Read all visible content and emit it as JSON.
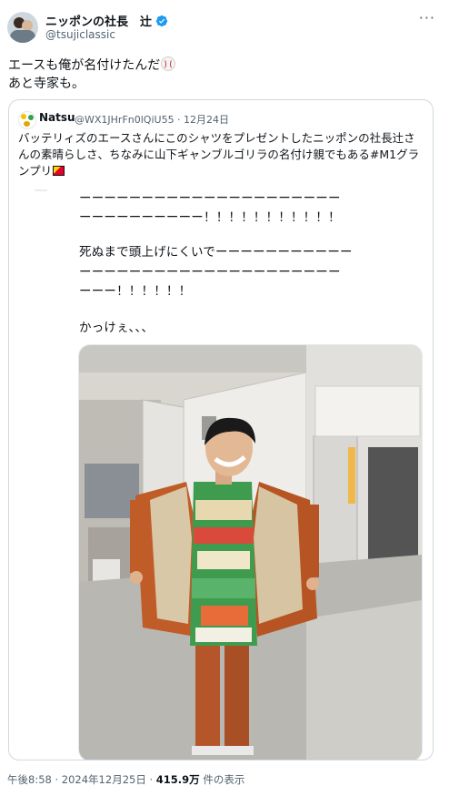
{
  "author": {
    "display_name": "ニッポンの社長　辻",
    "handle": "@tsujiclassic",
    "verified_icon": "verified-badge-icon",
    "more_label": "···"
  },
  "tweet": {
    "line1": "エースも俺が名付けたんだ",
    "line2": "あと寺家も。"
  },
  "quote": {
    "display_name": "Natsu",
    "meta": "@WX1JHrFn0lQiU55 · 12月24日",
    "text": "バッテリィズのエースさんにこのシャツをプレゼントしたニッポンの社長辻さんの素晴らしさ、ちなみに山下ギャンブルゴリラの名付け親でもある#M1グランプリ",
    "note_lines": [
      "ーーーーーーーーーーーーーーーーーーーーー",
      "ーーーーーーーーーー！！！！！！！！！！！",
      "死ぬまで頭上げにくいでーーーーーーーーーーー",
      "ーーーーーーーーーーーーーーーーーーーーー",
      "ーーー！！！！！！",
      "かっけぇ､､､"
    ]
  },
  "footer": {
    "time": "午後8:58 · 2024年12月25日 · ",
    "views": "415.9万",
    "views_suffix": " 件の表示"
  },
  "colors": {
    "accent": "#1d9bf0",
    "muted": "#536471",
    "border": "#cfd9de"
  }
}
